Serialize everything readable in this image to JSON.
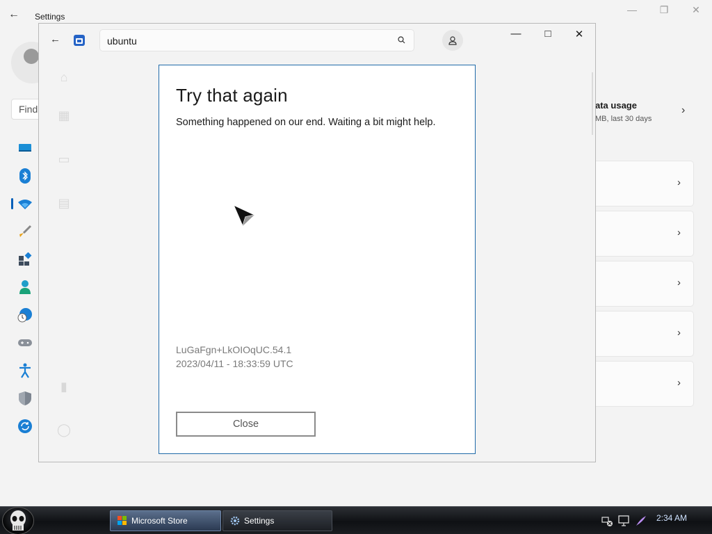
{
  "settings": {
    "title": "Settings",
    "find_text": "Find",
    "data_usage": {
      "title": "Data usage",
      "title_visible": "ata usage",
      "subtitle_visible": "MB, last 30 days"
    }
  },
  "store": {
    "search_value": "ubuntu"
  },
  "dialog": {
    "title": "Try that again",
    "message": "Something happened on our end. Waiting a bit might help.",
    "code": "LuGaFgn+LkOIOqUC.54.1",
    "timestamp": "2023/04/11 - 18:33:59 UTC",
    "close_label": "Close"
  },
  "taskbar": {
    "items": [
      {
        "label": "Microsoft Store",
        "icon": "store-icon",
        "active": true
      },
      {
        "label": "Settings",
        "icon": "gear-icon",
        "active": false
      }
    ],
    "clock": "2:34 AM"
  },
  "colors": {
    "accent": "#005fb8",
    "dialog_border": "#1f6aa8"
  }
}
